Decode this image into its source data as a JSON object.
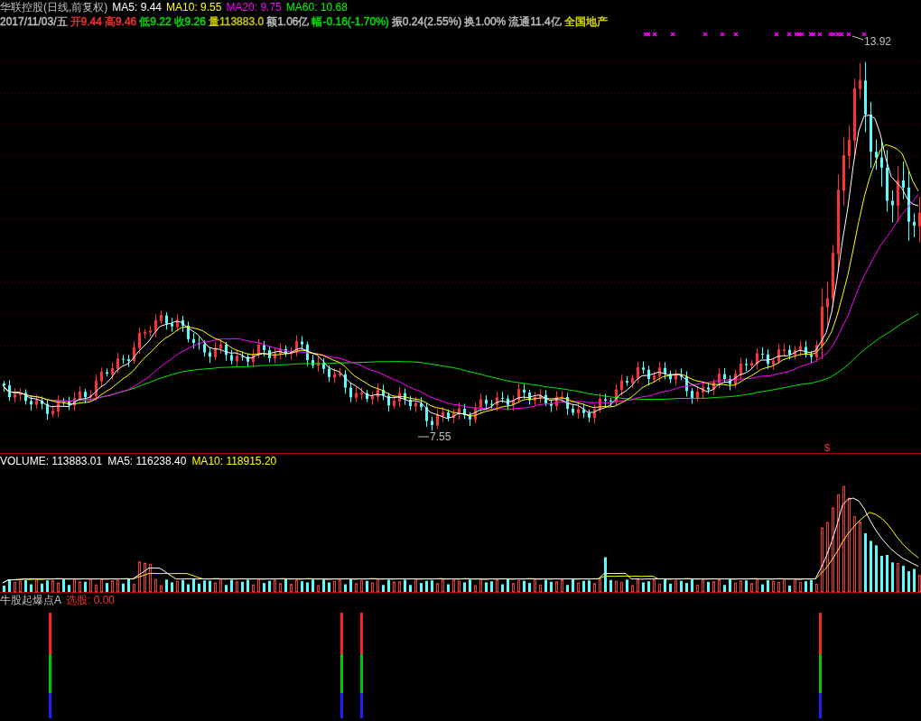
{
  "price_panel": {
    "stock_title": "华联控股(日线,前复权)",
    "moving_averages": [
      {
        "text": "MA5: 9.44",
        "color": "#ffffff"
      },
      {
        "text": "MA10: 9.55",
        "color": "#ffff00"
      },
      {
        "text": "MA20: 9.75",
        "color": "#ff00ff"
      },
      {
        "text": "MA60: 10.68",
        "color": "#00ff00"
      }
    ],
    "quote_items": [
      {
        "text": "2017/11/03/五",
        "color": "#c0c0c0"
      },
      {
        "text": "开9.44",
        "color": "#ff3232"
      },
      {
        "text": "高9.46",
        "color": "#ff3232"
      },
      {
        "text": "低9.22",
        "color": "#00e600"
      },
      {
        "text": "收9.26",
        "color": "#00e600"
      },
      {
        "text": "量113883.0",
        "color": "#c8c800"
      },
      {
        "text": "额1.06亿",
        "color": "#c0c0c0"
      },
      {
        "text": "幅-0.16(-1.70%)",
        "color": "#00e600"
      },
      {
        "text": "振0.24(2.55%)",
        "color": "#c0c0c0"
      },
      {
        "text": "换1.00%",
        "color": "#c0c0c0"
      },
      {
        "text": "流通11.4亿",
        "color": "#c0c0c0"
      },
      {
        "text": "全国地产",
        "color": "#e0e000"
      }
    ],
    "high_label": "13.92",
    "low_label": "7.55",
    "signal_mark": "$"
  },
  "volume_panel": {
    "readings": [
      {
        "text": "VOLUME: 113883.01",
        "color": "#ffffff"
      },
      {
        "text": "MA5: 116238.40",
        "color": "#ffffff"
      },
      {
        "text": "MA10: 118915.20",
        "color": "#ffff00"
      }
    ]
  },
  "indicator_panel": {
    "name": "牛股起爆点A",
    "reading": "选股: 0.00"
  }
}
